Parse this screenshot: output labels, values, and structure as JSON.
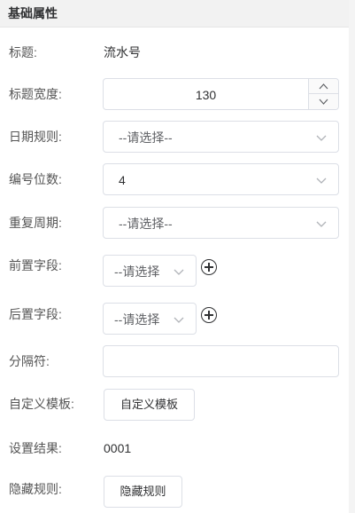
{
  "section": {
    "title": "基础属性"
  },
  "fields": {
    "title": {
      "label": "标题:",
      "value": "流水号"
    },
    "title_width": {
      "label": "标题宽度:",
      "value": "130"
    },
    "date_rule": {
      "label": "日期规则:",
      "value": "--请选择--"
    },
    "digits": {
      "label": "编号位数:",
      "value": "4"
    },
    "repeat_cycle": {
      "label": "重复周期:",
      "value": "--请选择--"
    },
    "prefix_field": {
      "label": "前置字段:",
      "value": "--请选择"
    },
    "suffix_field": {
      "label": "后置字段:",
      "value": "--请选择"
    },
    "separator": {
      "label": "分隔符:",
      "value": ""
    },
    "custom_template": {
      "label": "自定义模板:",
      "button": "自定义模板"
    },
    "result": {
      "label": "设置结果:",
      "value": "0001"
    },
    "hide_rule": {
      "label": "隐藏规则:",
      "button": "隐藏规则"
    }
  },
  "icons": [
    "chevron-down-icon",
    "chevron-up-icon",
    "plus-circle-icon"
  ]
}
